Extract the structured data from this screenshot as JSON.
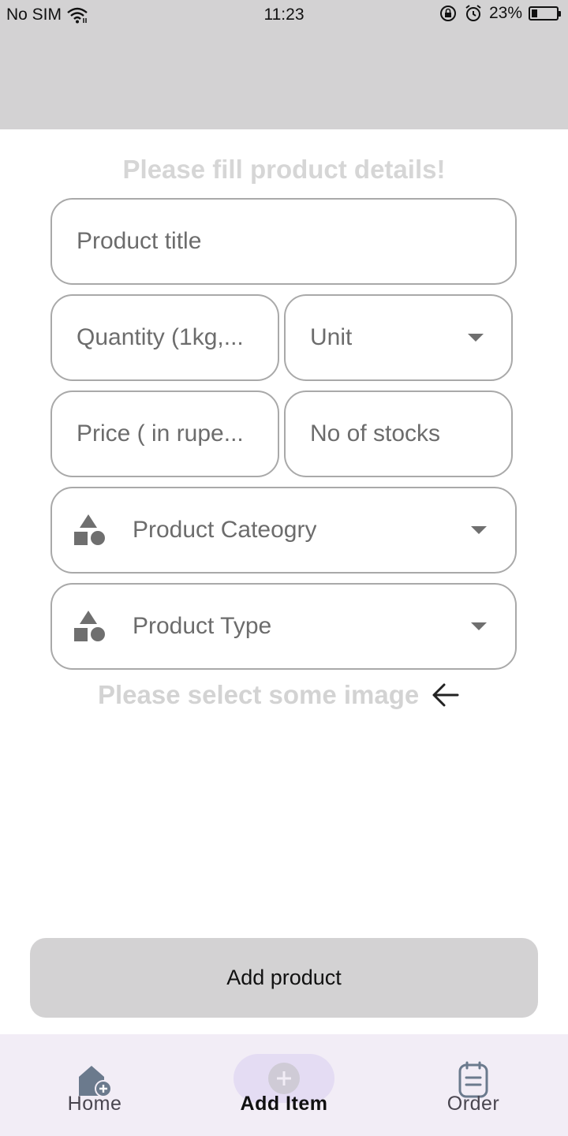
{
  "status_bar": {
    "carrier": "No SIM",
    "time": "11:23",
    "battery": "23%",
    "battery_level": 0.23
  },
  "form": {
    "heading": "Please fill product details!",
    "product_title_placeholder": "Product title",
    "quantity_placeholder": "Quantity (1kg,...",
    "unit_label": "Unit",
    "price_placeholder": "Price ( in rupe...",
    "stocks_placeholder": "No of stocks",
    "category_label": "Product Cateogry",
    "type_label": "Product Type",
    "image_hint": "Please select some image"
  },
  "actions": {
    "add_product_label": "Add product"
  },
  "bottom_nav": {
    "items": [
      {
        "label": "Home",
        "icon": "home-add-icon",
        "active": false
      },
      {
        "label": "Add Item",
        "icon": "add-circle-icon",
        "active": true
      },
      {
        "label": "Order",
        "icon": "notepad-icon",
        "active": false
      }
    ]
  },
  "colors": {
    "header": "#d3d2d3",
    "nav_background": "#f2edf6",
    "active_pill": "#e4dcf3"
  }
}
